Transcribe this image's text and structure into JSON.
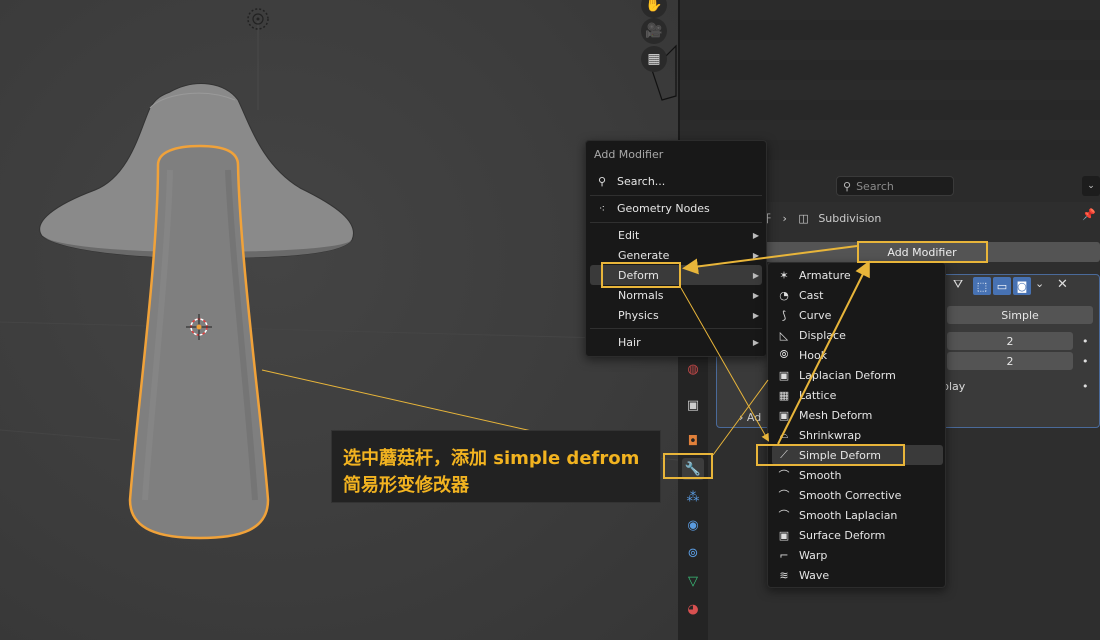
{
  "colors": {
    "accent": "#e8b53a",
    "selection": "#f0a23a",
    "menu_bg": "#181818",
    "active_item": "#3a3a3a"
  },
  "viewport": {
    "nav_icons": [
      "hand-icon",
      "camera-icon",
      "grid-icon"
    ]
  },
  "properties_header": {
    "search_placeholder": "Search"
  },
  "breadcrumb": {
    "object_fragment": "杆",
    "separator": "›",
    "modifier_name": "Subdivision"
  },
  "add_modifier_button": "Add Modifier",
  "subdivision_panel": {
    "mode_label": "Simple",
    "levels_viewport": "2",
    "render_levels": "2",
    "display_label_fragment": "play",
    "advanced_fragment": "Ad"
  },
  "main_menu": {
    "title": "Add Modifier",
    "search": "Search...",
    "geometry_nodes": "Geometry Nodes",
    "items": [
      {
        "label": "Edit",
        "submenu": true
      },
      {
        "label": "Generate",
        "submenu": true
      },
      {
        "label": "Deform",
        "submenu": true,
        "active": true
      },
      {
        "label": "Normals",
        "submenu": true
      },
      {
        "label": "Physics",
        "submenu": true
      },
      {
        "label": "Hair",
        "submenu": true
      }
    ]
  },
  "deform_menu": {
    "items": [
      {
        "label": "Armature",
        "icon": "armature-icon"
      },
      {
        "label": "Cast",
        "icon": "cast-icon"
      },
      {
        "label": "Curve",
        "icon": "curve-icon"
      },
      {
        "label": "Displace",
        "icon": "displace-icon"
      },
      {
        "label": "Hook",
        "icon": "hook-icon"
      },
      {
        "label": "Laplacian Deform",
        "icon": "laplacian-deform-icon"
      },
      {
        "label": "Lattice",
        "icon": "lattice-icon"
      },
      {
        "label": "Mesh Deform",
        "icon": "mesh-deform-icon"
      },
      {
        "label": "Shrinkwrap",
        "icon": "shrinkwrap-icon"
      },
      {
        "label": "Simple Deform",
        "icon": "simple-deform-icon",
        "active": true
      },
      {
        "label": "Smooth",
        "icon": "smooth-icon"
      },
      {
        "label": "Smooth Corrective",
        "icon": "smooth-corrective-icon"
      },
      {
        "label": "Smooth Laplacian",
        "icon": "smooth-laplacian-icon"
      },
      {
        "label": "Surface Deform",
        "icon": "surface-deform-icon"
      },
      {
        "label": "Warp",
        "icon": "warp-icon"
      },
      {
        "label": "Wave",
        "icon": "wave-icon"
      }
    ]
  },
  "annotation": {
    "line1": "选中蘑菇杆，添加 simple defrom",
    "line2": "简易形变修改器"
  }
}
